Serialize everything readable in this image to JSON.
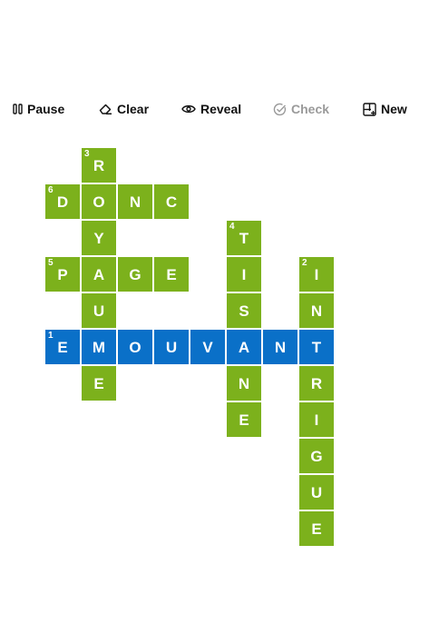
{
  "toolbar": {
    "pause_label": "Pause",
    "clear_label": "Clear",
    "reveal_label": "Reveal",
    "check_label": "Check",
    "new_label": "New"
  },
  "colors": {
    "green": "#7cb11c",
    "blue": "#0a70c8"
  },
  "crossword": {
    "cells": [
      {
        "col": 1,
        "row": 0,
        "letter": "R",
        "num": "3",
        "active": false
      },
      {
        "col": 0,
        "row": 1,
        "letter": "D",
        "num": "6",
        "active": false
      },
      {
        "col": 1,
        "row": 1,
        "letter": "O",
        "num": "",
        "active": false
      },
      {
        "col": 2,
        "row": 1,
        "letter": "N",
        "num": "",
        "active": false
      },
      {
        "col": 3,
        "row": 1,
        "letter": "C",
        "num": "",
        "active": false
      },
      {
        "col": 1,
        "row": 2,
        "letter": "Y",
        "num": "",
        "active": false
      },
      {
        "col": 5,
        "row": 2,
        "letter": "T",
        "num": "4",
        "active": false
      },
      {
        "col": 0,
        "row": 3,
        "letter": "P",
        "num": "5",
        "active": false
      },
      {
        "col": 1,
        "row": 3,
        "letter": "A",
        "num": "",
        "active": false
      },
      {
        "col": 2,
        "row": 3,
        "letter": "G",
        "num": "",
        "active": false
      },
      {
        "col": 3,
        "row": 3,
        "letter": "E",
        "num": "",
        "active": false
      },
      {
        "col": 5,
        "row": 3,
        "letter": "I",
        "num": "",
        "active": false
      },
      {
        "col": 7,
        "row": 3,
        "letter": "I",
        "num": "2",
        "active": false
      },
      {
        "col": 1,
        "row": 4,
        "letter": "U",
        "num": "",
        "active": false
      },
      {
        "col": 5,
        "row": 4,
        "letter": "S",
        "num": "",
        "active": false
      },
      {
        "col": 7,
        "row": 4,
        "letter": "N",
        "num": "",
        "active": false
      },
      {
        "col": 0,
        "row": 5,
        "letter": "E",
        "num": "1",
        "active": true
      },
      {
        "col": 1,
        "row": 5,
        "letter": "M",
        "num": "",
        "active": true
      },
      {
        "col": 2,
        "row": 5,
        "letter": "O",
        "num": "",
        "active": true
      },
      {
        "col": 3,
        "row": 5,
        "letter": "U",
        "num": "",
        "active": true
      },
      {
        "col": 4,
        "row": 5,
        "letter": "V",
        "num": "",
        "active": true
      },
      {
        "col": 5,
        "row": 5,
        "letter": "A",
        "num": "",
        "active": true
      },
      {
        "col": 6,
        "row": 5,
        "letter": "N",
        "num": "",
        "active": true
      },
      {
        "col": 7,
        "row": 5,
        "letter": "T",
        "num": "",
        "active": true
      },
      {
        "col": 1,
        "row": 6,
        "letter": "E",
        "num": "",
        "active": false
      },
      {
        "col": 5,
        "row": 6,
        "letter": "N",
        "num": "",
        "active": false
      },
      {
        "col": 7,
        "row": 6,
        "letter": "R",
        "num": "",
        "active": false
      },
      {
        "col": 5,
        "row": 7,
        "letter": "E",
        "num": "",
        "active": false
      },
      {
        "col": 7,
        "row": 7,
        "letter": "I",
        "num": "",
        "active": false
      },
      {
        "col": 7,
        "row": 8,
        "letter": "G",
        "num": "",
        "active": false
      },
      {
        "col": 7,
        "row": 9,
        "letter": "U",
        "num": "",
        "active": false
      },
      {
        "col": 7,
        "row": 10,
        "letter": "E",
        "num": "",
        "active": false
      }
    ]
  }
}
